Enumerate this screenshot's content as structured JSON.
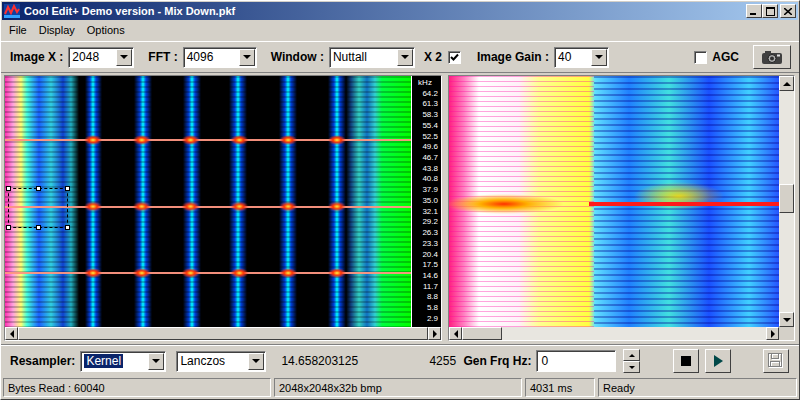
{
  "window": {
    "title": "Cool Edit+ Demo version - Mix Down.pkf"
  },
  "menu": [
    {
      "label": "File"
    },
    {
      "label": "Display"
    },
    {
      "label": "Options"
    }
  ],
  "toolbar": {
    "image_x": {
      "label": "Image X :",
      "value": "2048"
    },
    "fft": {
      "label": "FFT :",
      "value": "4096"
    },
    "window": {
      "label": "Window :",
      "value": "Nuttall"
    },
    "x2": {
      "label": "X 2",
      "checked": true
    },
    "image_gain": {
      "label": "Image Gain :",
      "value": "40"
    },
    "agc": {
      "label": "AGC",
      "checked": false
    }
  },
  "spectrogram": {
    "unit": "kHz",
    "ticks": [
      "64.2",
      "61.3",
      "58.3",
      "55.4",
      "52.5",
      "49.6",
      "46.7",
      "43.8",
      "40.8",
      "37.9",
      "35.0",
      "32.1",
      "29.2",
      "26.3",
      "23.3",
      "20.4",
      "17.5",
      "14.6",
      "11.7",
      "8.8",
      "5.8",
      "2.9"
    ],
    "selection_visible": true,
    "scroll": {
      "position": 0.0,
      "size": 1.0
    }
  },
  "spectrum": {
    "vscroll": {
      "position": 0.42,
      "size": 0.13
    },
    "hscroll": {
      "position": 0.0,
      "size": 0.13
    }
  },
  "controls": {
    "resampler": {
      "label": "Resampler:",
      "value": "Kernel",
      "focused": true
    },
    "filter": {
      "value": "Lanczos"
    },
    "ratio": "14.658203125",
    "count": "4255",
    "generator": {
      "label": "Gen Frq Hz:",
      "value": "0"
    },
    "buttons": [
      {
        "kind": "stop",
        "disabled": false
      },
      {
        "kind": "play",
        "disabled": false
      },
      {
        "kind": "save",
        "disabled": true
      }
    ]
  },
  "status_bar": [
    {
      "text": "Bytes Read : 60040"
    },
    {
      "text": "2048x2048x32b bmp"
    },
    {
      "text": "4031 ms"
    },
    {
      "text": "Ready"
    }
  ]
}
